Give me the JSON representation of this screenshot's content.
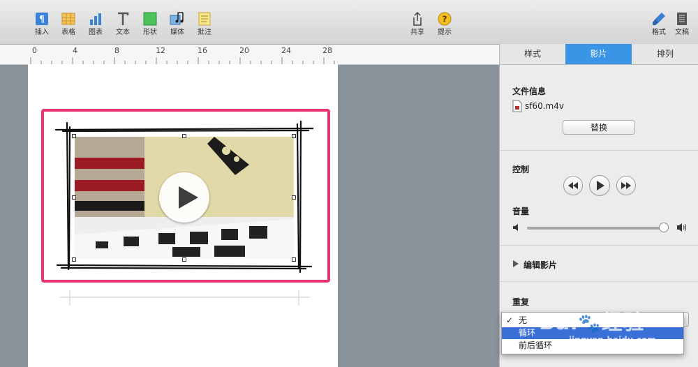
{
  "toolbar": {
    "left_items": [
      {
        "label": "插入",
        "icon": "paragraph-icon"
      },
      {
        "label": "表格",
        "icon": "table-icon"
      },
      {
        "label": "图表",
        "icon": "chart-icon"
      },
      {
        "label": "文本",
        "icon": "text-icon"
      },
      {
        "label": "形状",
        "icon": "shape-icon"
      },
      {
        "label": "媒体",
        "icon": "media-icon"
      },
      {
        "label": "批注",
        "icon": "comment-icon"
      }
    ],
    "center_items": [
      {
        "label": "共享",
        "icon": "share-icon"
      },
      {
        "label": "提示",
        "icon": "tips-icon"
      }
    ],
    "right_items": [
      {
        "label": "格式",
        "icon": "format-brush-icon"
      },
      {
        "label": "文稿",
        "icon": "document-icon"
      }
    ]
  },
  "ruler": {
    "marks": [
      "0",
      "4",
      "8",
      "12",
      "16",
      "20",
      "24",
      "28"
    ]
  },
  "panel": {
    "tabs": [
      {
        "label": "样式",
        "active": false
      },
      {
        "label": "影片",
        "active": true
      },
      {
        "label": "排列",
        "active": false
      }
    ],
    "file_info": {
      "title": "文件信息",
      "filename": "sf60.m4v",
      "replace_label": "替换"
    },
    "controls": {
      "title": "控制"
    },
    "volume": {
      "title": "音量",
      "level": 0.98
    },
    "edit_movie": {
      "label": "编辑影片"
    },
    "repeat": {
      "title": "重复",
      "options": [
        {
          "label": "无",
          "checked": true,
          "highlighted": false
        },
        {
          "label": "循环",
          "checked": false,
          "highlighted": true
        },
        {
          "label": "前后循环",
          "checked": false,
          "highlighted": false
        }
      ]
    }
  },
  "watermark": {
    "brand": "Bai",
    "brand2": "经验",
    "url": "jingyan.baidu.com"
  },
  "colors": {
    "accent": "#3b95e6",
    "selection": "#e8356d",
    "highlight": "#3b6fd8"
  }
}
